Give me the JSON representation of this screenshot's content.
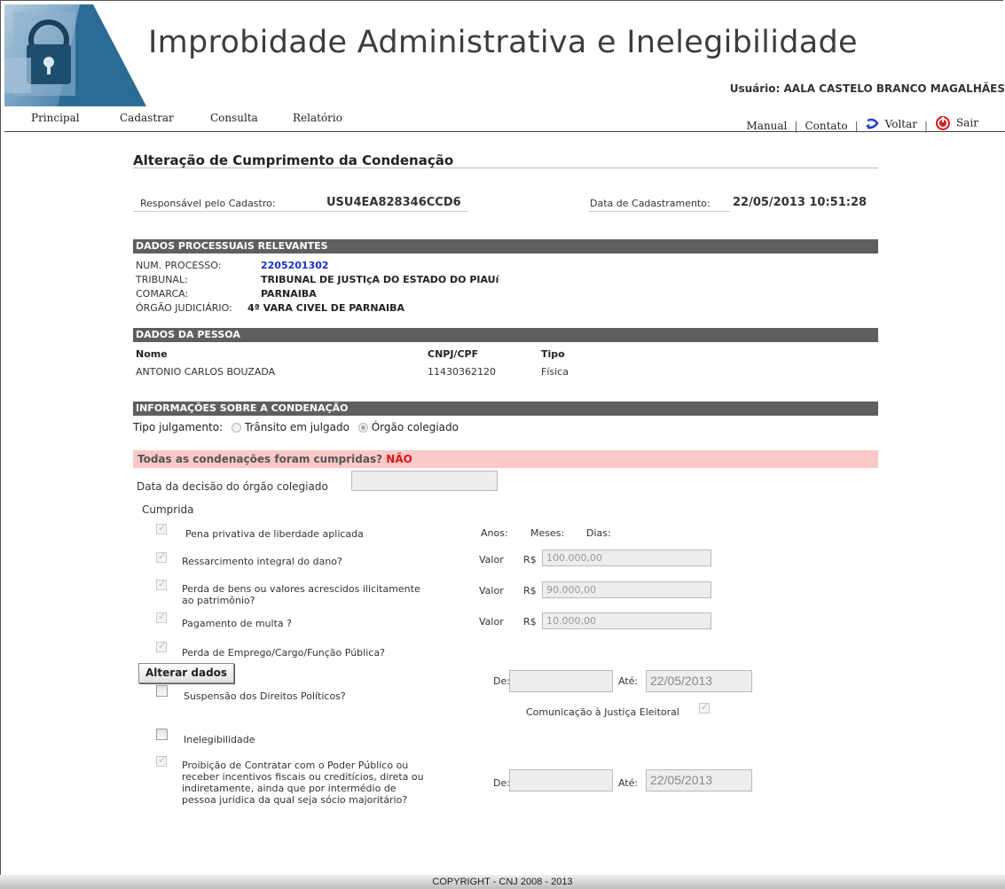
{
  "header": {
    "title": "Improbidade Administrativa e Inelegibilidade",
    "user_label": "Usuário:",
    "user_name": "AALA CASTELO BRANCO MAGALHÃES"
  },
  "nav": {
    "principal": "Principal",
    "cadastrar": "Cadastrar",
    "consulta": "Consulta",
    "relatorio": "Relatório",
    "manual": "Manual",
    "contato": "Contato",
    "voltar": "Voltar",
    "sair": "Sair",
    "separator": "|"
  },
  "page": {
    "title": "Alteração de Cumprimento da Condenação",
    "responsavel_label": "Responsável pelo Cadastro:",
    "responsavel_value": "USU4EA828346CCD6",
    "data_cad_label": "Data de Cadastramento:",
    "data_cad_value": "22/05/2013 10:51:28"
  },
  "processo": {
    "header": "DADOS PROCESSUAIS RELEVANTES",
    "num_label": "NUM. PROCESSO:",
    "num_value": "2205201302",
    "tribunal_label": "TRIBUNAL:",
    "tribunal_value": "TRIBUNAL DE JUSTIçA DO ESTADO DO PIAUí",
    "comarca_label": "COMARCA:",
    "comarca_value": "PARNAIBA",
    "orgao_label": "ÓRGÃO JUDICIÁRIO:",
    "orgao_value": "4ª VARA CIVEL DE PARNAIBA"
  },
  "pessoa": {
    "header": "DADOS DA PESSOA",
    "col_nome": "Nome",
    "col_cnpj": "CNPJ/CPF",
    "col_tipo": "Tipo",
    "nome": "ANTONIO CARLOS BOUZADA",
    "cnpj": "11430362120",
    "tipo": "Física"
  },
  "condenacao": {
    "header": "INFORMAÇÕES SOBRE A CONDENAÇÃO",
    "tipo_label": "Tipo julgamento:",
    "opt_transito": "Trânsito em julgado",
    "opt_orgao": "Órgão colegiado",
    "selected": "Órgão colegiado",
    "todas_label": "Todas as condenações foram cumpridas?",
    "todas_value": "NÃO",
    "data_decisao_label": "Data da decisão do órgão colegiado",
    "data_decisao_value": "",
    "cumprida_label": "Cumprida"
  },
  "items": {
    "pena": {
      "label": "Pena privativa de liberdade aplicada",
      "anos": "Anos:",
      "meses": "Meses:",
      "dias": "Dias:",
      "checked": true
    },
    "ressarcimento": {
      "label": "Ressarcimento integral do dano?",
      "valor_label": "Valor",
      "currency": "R$",
      "valor": "100.000,00",
      "checked": true
    },
    "perda_bens": {
      "label_1": "Perda de bens ou valores acrescidos ilicitamente",
      "label_2": "ao patrimônio?",
      "valor_label": "Valor",
      "currency": "R$",
      "valor": "90.000,00",
      "checked": true
    },
    "multa": {
      "label": "Pagamento de multa ?",
      "valor_label": "Valor",
      "currency": "R$",
      "valor": "10.000,00",
      "checked": true
    },
    "perda_emprego": {
      "label": "Perda de Emprego/Cargo/Função Pública?",
      "checked": true
    },
    "suspensao": {
      "label": "Suspensão dos Direitos Políticos?",
      "de_label": "De:",
      "de_value": "",
      "ate_label": "Até:",
      "ate_value": "22/05/2013",
      "comunicacao_label": "Comunicação à Justiça Eleitoral",
      "checked": false
    },
    "inelegibilidade": {
      "label": "Inelegibilidade",
      "checked": false
    },
    "proibicao": {
      "label_1": "Proibição de Contratar com o Poder Público ou",
      "label_2": "receber incentivos fiscais ou creditícios, direta ou",
      "label_3": "indiretamente, ainda que por intermédio de",
      "label_4": "pessoa jurídica da qual seja sócio majoritário?",
      "de_label": "De:",
      "de_value": "",
      "ate_label": "Até:",
      "ate_value": "22/05/2013",
      "checked": true
    }
  },
  "actions": {
    "alterar": "Alterar dados"
  },
  "footer": {
    "copyright": "COPYRIGHT - CNJ 2008 - 2013"
  },
  "colors": {
    "section_bg": "#5f5f5f",
    "alert_bg": "#fbc8c8",
    "alert_text": "#e01515",
    "link": "#1a2fcf"
  }
}
